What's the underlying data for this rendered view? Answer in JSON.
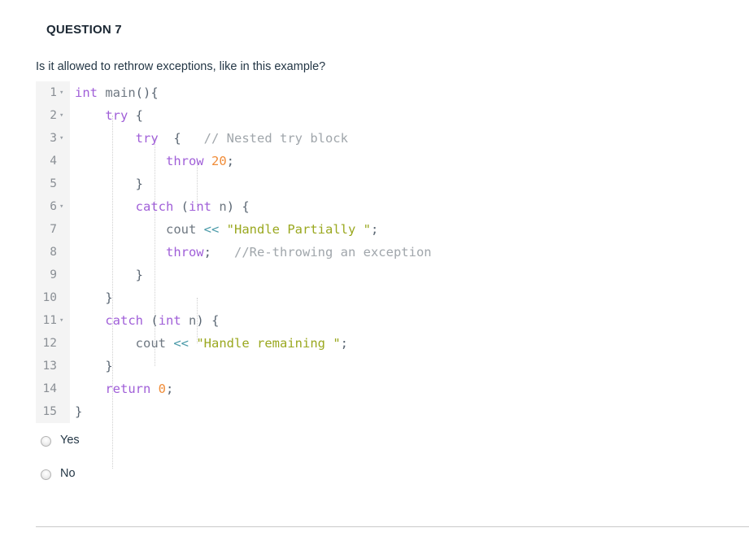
{
  "question": {
    "title": "QUESTION 7",
    "prompt": "Is it allowed to rethrow exceptions, like in this example?"
  },
  "code_editor": {
    "language": "cpp",
    "fold_marker": "▾",
    "lines": [
      {
        "number": "1",
        "foldable": true,
        "text": "int main(){"
      },
      {
        "number": "2",
        "foldable": true,
        "text": "    try {"
      },
      {
        "number": "3",
        "foldable": true,
        "text": "        try  {   // Nested try block"
      },
      {
        "number": "4",
        "foldable": false,
        "text": "            throw 20;"
      },
      {
        "number": "5",
        "foldable": false,
        "text": "        }"
      },
      {
        "number": "6",
        "foldable": true,
        "text": "        catch (int n) {"
      },
      {
        "number": "7",
        "foldable": false,
        "text": "            cout << \"Handle Partially \";"
      },
      {
        "number": "8",
        "foldable": false,
        "text": "            throw;   //Re-throwing an exception"
      },
      {
        "number": "9",
        "foldable": false,
        "text": "        }"
      },
      {
        "number": "10",
        "foldable": false,
        "text": "    }"
      },
      {
        "number": "11",
        "foldable": true,
        "text": "    catch (int n) {"
      },
      {
        "number": "12",
        "foldable": false,
        "text": "        cout << \"Handle remaining \";"
      },
      {
        "number": "13",
        "foldable": false,
        "text": "    }"
      },
      {
        "number": "14",
        "foldable": false,
        "text": "    return 0;"
      },
      {
        "number": "15",
        "foldable": false,
        "text": "}"
      }
    ]
  },
  "answers": {
    "options": [
      {
        "label": "Yes",
        "selected": false
      },
      {
        "label": "No",
        "selected": false
      }
    ]
  },
  "colors": {
    "keyword": "#a05fd8",
    "number": "#f08c38",
    "string": "#9aa81f",
    "comment": "#a0a6ab",
    "operator": "#4a9aa8",
    "punctuation": "#5a6673",
    "identifier": "#6e7781",
    "gutter_bg": "#f4f4f4",
    "line_number": "#8a8f95",
    "divider": "#c9c9c9"
  }
}
